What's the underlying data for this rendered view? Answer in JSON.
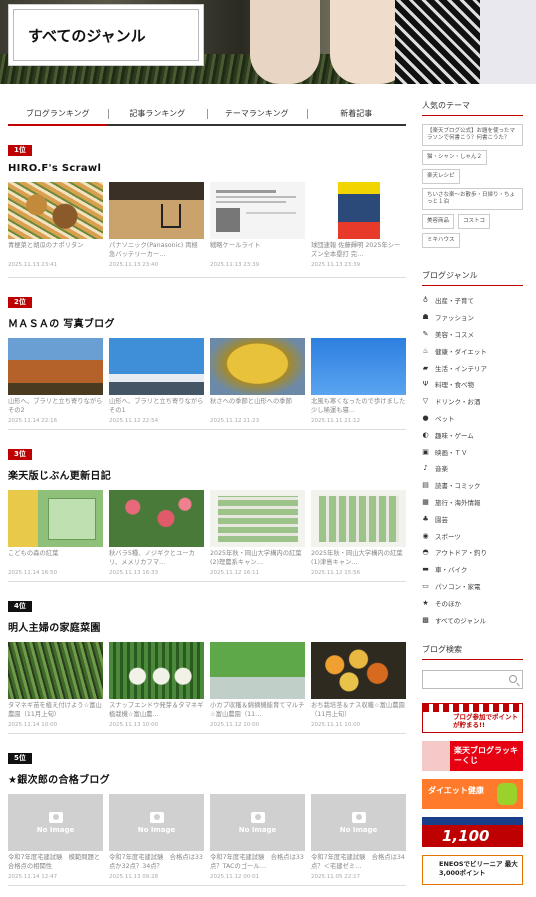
{
  "header": {
    "title": "すべてのジャンル"
  },
  "tabs": [
    {
      "label": "ブログランキング",
      "active": true
    },
    {
      "label": "記事ランキング",
      "active": false
    },
    {
      "label": "テーマランキング",
      "active": false
    },
    {
      "label": "新着記事",
      "active": false
    }
  ],
  "rankings": [
    {
      "badge": "1位",
      "name": "HIRO.F's Scrawl",
      "articles": [
        {
          "title": "青梗菜と胡瓜のナポリタン",
          "date": "2025.11.13 23:41"
        },
        {
          "title": "パナソニック(Panasonic) 両極急バッテリーカー…",
          "date": "2025.11.13 23:40"
        },
        {
          "title": "戦略ケールライト",
          "date": "2025.11.13 23:39"
        },
        {
          "title": "球団速報 佐藤輝明 2025年シーズン全本塁打 完…",
          "date": "2025.11.13 23:39"
        }
      ]
    },
    {
      "badge": "2位",
      "name": "ＭＡＳＡの 写真ブログ",
      "articles": [
        {
          "title": "山形へ、ブラリと立ち寄りながら　その2",
          "date": "2025.11.14 22:16"
        },
        {
          "title": "山形へ、ブラリと立ち寄りながら　その1",
          "date": "2025.11.12 22:54"
        },
        {
          "title": "秋さへの季節と山形への季節",
          "date": "2025.11.12 21:23"
        },
        {
          "title": "北風も寒くなったので歩けました 少し稀運も寝…",
          "date": "2025.11.11 21:12"
        }
      ]
    },
    {
      "badge": "3位",
      "name": "楽天版じぶん更新日記",
      "articles": [
        {
          "title": "こどもの森の紅葉",
          "date": "2025.11.14 16:50"
        },
        {
          "title": "秋バラ5種、ノジギクとユーカリ、メメリカフマ…",
          "date": "2025.11.13 16:33"
        },
        {
          "title": "2025年秋・岡山大学構内の紅葉(2)理農系キャン…",
          "date": "2025.11.12 16:11"
        },
        {
          "title": "2025年秋・岡山大学構内の紅葉(1)津島キャン…",
          "date": "2025.11.12 15:56"
        }
      ]
    },
    {
      "badge": "4位",
      "name": "明人主婦の家庭菜園",
      "articles": [
        {
          "title": "タマネギ苗を植え付けよう☆富山農園（11月上旬）",
          "date": "2025.11.14 10:00"
        },
        {
          "title": "スナップエンドウ発芽＆タマネギ植栽機☆富山農…",
          "date": "2025.11.13 10:00"
        },
        {
          "title": "小カブ収穫＆綿摘機能育てマルチ☆富山農園（11…",
          "date": "2025.11.12 10:00"
        },
        {
          "title": "おち栽培茎＆ナス収穫☆富山農園（11月上旬）",
          "date": "2025.11.11 10:00"
        }
      ]
    },
    {
      "badge": "5位",
      "name": "★銀次郎の合格ブログ",
      "articles": [
        {
          "title": "令和7年度宅建試験　模範問題と合格点の相関性",
          "date": "2025.11.14 12:47"
        },
        {
          "title": "令和7年度宅建試験　合格点は33点か32点？34点？",
          "date": "2025.11.13 09:28"
        },
        {
          "title": "令和7年度宅建試験　合格点は33点？TACのゴール…",
          "date": "2025.11.12 00:01"
        },
        {
          "title": "令和7年度宅建試験　合格点は34点？＜宅建ゼミ…",
          "date": "2025.11.05 22:17"
        }
      ]
    }
  ],
  "no_image_label": "No Image",
  "sidebar": {
    "themes_title": "人気のテーマ",
    "themes": [
      "【楽天ブログ公式】お題を使ったマラソンで何書こう？何書こうた？",
      "猫・シャン・しゃん２",
      "楽天レシピ",
      "ちいさな楽～お散歩・日帰り・ちょっと１泊",
      "美容商品",
      "コストコ",
      "ミキハウス"
    ],
    "genres_title": "ブログジャンル",
    "genres": [
      {
        "label": "出産・子育て",
        "icon": "baby-bottle-icon",
        "glyph": "♁"
      },
      {
        "label": "ファッション",
        "icon": "hat-icon",
        "glyph": "☗"
      },
      {
        "label": "美容・コスメ",
        "icon": "lipstick-icon",
        "glyph": "✎"
      },
      {
        "label": "健康・ダイエット",
        "icon": "runner-icon",
        "glyph": "♨"
      },
      {
        "label": "生活・インテリア",
        "icon": "sofa-icon",
        "glyph": "▰"
      },
      {
        "label": "料理・食べ物",
        "icon": "knife-fork-icon",
        "glyph": "Ψ"
      },
      {
        "label": "ドリンク・お酒",
        "icon": "cocktail-icon",
        "glyph": "▽"
      },
      {
        "label": "ペット",
        "icon": "paw-icon",
        "glyph": "●"
      },
      {
        "label": "趣味・ゲーム",
        "icon": "gamepad-icon",
        "glyph": "◐"
      },
      {
        "label": "映画・ＴＶ",
        "icon": "tv-icon",
        "glyph": "▣"
      },
      {
        "label": "音楽",
        "icon": "music-note-icon",
        "glyph": "♪"
      },
      {
        "label": "読書・コミック",
        "icon": "book-icon",
        "glyph": "▤"
      },
      {
        "label": "旅行・海外情報",
        "icon": "suitcase-icon",
        "glyph": "▦"
      },
      {
        "label": "園芸",
        "icon": "plant-icon",
        "glyph": "♣"
      },
      {
        "label": "スポーツ",
        "icon": "ball-icon",
        "glyph": "◉"
      },
      {
        "label": "アウトドア・釣り",
        "icon": "cap-icon",
        "glyph": "◓"
      },
      {
        "label": "車・バイク",
        "icon": "car-icon",
        "glyph": "▬"
      },
      {
        "label": "パソコン・家電",
        "icon": "laptop-icon",
        "glyph": "▭"
      },
      {
        "label": "そのほか",
        "icon": "star-icon",
        "glyph": "★"
      },
      {
        "label": "すべてのジャンル",
        "icon": "all-icon",
        "glyph": "▩"
      }
    ],
    "search_title": "ブログ検索",
    "ads": [
      {
        "text": "ブログ参加でポイントが貯まる!!"
      },
      {
        "text": "楽天ブログラッキーくじ"
      },
      {
        "text": "ダイエット健康"
      },
      {
        "text": "1,100"
      },
      {
        "text": "ENEOSでビリーニア 最大3,000ポイント"
      }
    ]
  }
}
